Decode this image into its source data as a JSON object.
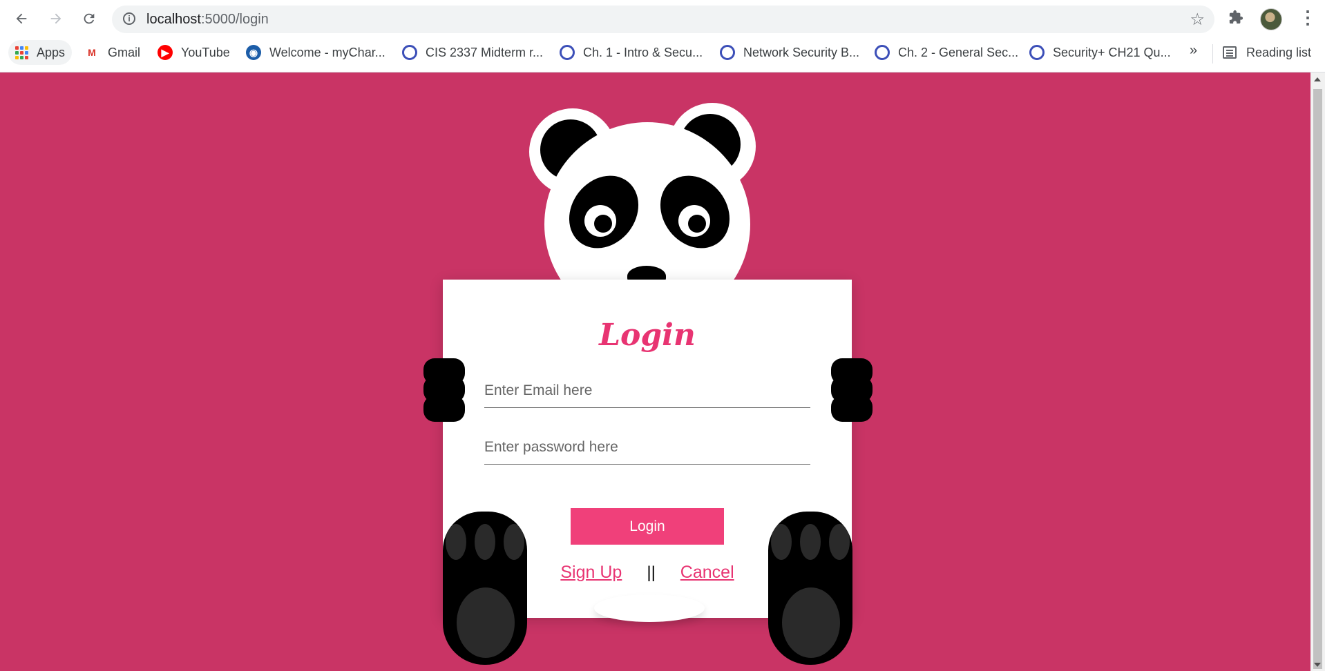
{
  "browser": {
    "url_host": "localhost",
    "url_path": ":5000/login",
    "bookmarks": [
      {
        "label": "Apps",
        "icon": "apps-grid-icon"
      },
      {
        "label": "Gmail",
        "icon": "gmail-icon"
      },
      {
        "label": "YouTube",
        "icon": "youtube-icon"
      },
      {
        "label": "Welcome - myChar...",
        "icon": "site-icon"
      },
      {
        "label": "CIS 2337 Midterm r...",
        "icon": "quizlet-icon"
      },
      {
        "label": "Ch. 1 - Intro & Secu...",
        "icon": "quizlet-icon"
      },
      {
        "label": "Network Security B...",
        "icon": "quizlet-icon"
      },
      {
        "label": "Ch. 2 - General Sec...",
        "icon": "quizlet-icon"
      },
      {
        "label": "Security+ CH21 Qu...",
        "icon": "quizlet-icon"
      }
    ],
    "more_bookmarks": "»",
    "reading_list": "Reading list"
  },
  "login": {
    "title": "Login",
    "email_placeholder": "Enter Email here",
    "password_placeholder": "Enter password here",
    "button_label": "Login",
    "signup_label": "Sign Up",
    "separator": "||",
    "cancel_label": "Cancel"
  },
  "colors": {
    "background": "#c93465",
    "accent": "#f0407a",
    "title": "#e83472"
  }
}
